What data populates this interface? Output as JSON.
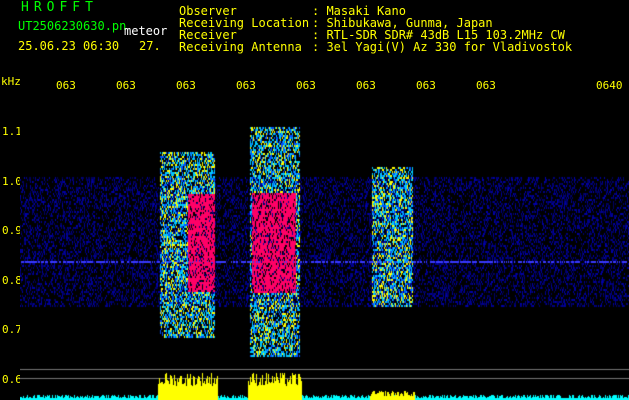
{
  "header": {
    "logo": "HROFFT",
    "filename": "UT2506230630.pn",
    "datetime": "25.06.23 06:30",
    "count": "27.",
    "tag": "meteor"
  },
  "meta": {
    "rows": [
      {
        "label": "Observer",
        "value": ": Masaki Kano"
      },
      {
        "label": "Receiving Location",
        "value": ": Shibukawa, Gunma, Japan"
      },
      {
        "label": "Receiver",
        "value": ": RTL-SDR SDR# 43dB L15 103.2MHz CW"
      },
      {
        "label": "Receiving Antenna",
        "value": ": 3el Yagi(V) Az 330 for Vladivostok"
      }
    ]
  },
  "axis": {
    "y_unit": "kHz",
    "y_ticks": [
      {
        "label": "1.1",
        "value": 1.1
      },
      {
        "label": "1.0",
        "value": 1.0
      },
      {
        "label": "0.9",
        "value": 0.9
      },
      {
        "label": "0.8",
        "value": 0.8
      },
      {
        "label": "0.7",
        "value": 0.7
      },
      {
        "label": "0.6",
        "value": 0.6
      }
    ],
    "x_ticks": [
      "063",
      "063",
      "063",
      "063",
      "063",
      "063",
      "063",
      "063",
      "0640"
    ]
  },
  "colors": {
    "background": "#000000",
    "noise_band": "#0000aa",
    "signal_low": "#00c8ff",
    "signal_mid": "#ffff00",
    "signal_high": "#ff0066",
    "amplitude": "#ffff00",
    "baseline": "#00ffff"
  }
}
